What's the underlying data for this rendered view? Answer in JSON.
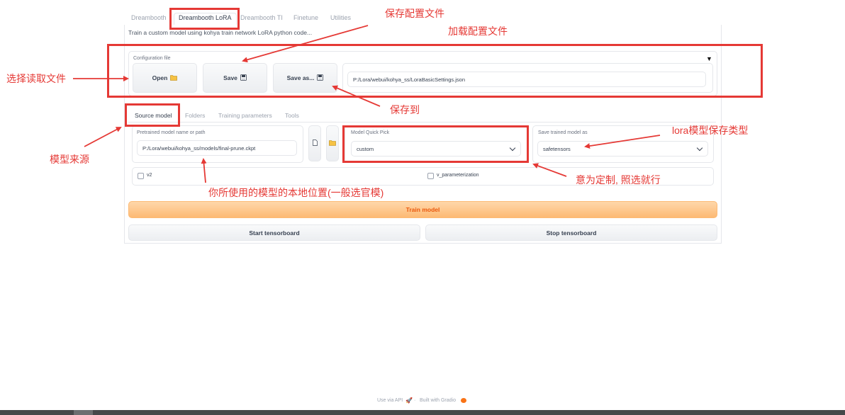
{
  "top_tabs": [
    "Dreambooth",
    "Dreambooth LoRA",
    "Dreambooth TI",
    "Finetune",
    "Utilities"
  ],
  "description": "Train a custom model using kohya train network LoRA python code...",
  "config": {
    "label": "Configuration file",
    "collapse_glyph": "▼",
    "open_label": "Open",
    "save_label": "Save",
    "save_as_label": "Save as...",
    "path_value": "P:/Lora/webui/kohya_ss/LoraBasicSettings.json"
  },
  "sub_tabs": [
    "Source model",
    "Folders",
    "Training parameters",
    "Tools"
  ],
  "source": {
    "pretrained_label": "Pretrained model name or path",
    "pretrained_value": "P:/Lora/webui/kohya_ss/models/final-prune.ckpt",
    "quick_pick_label": "Model Quick Pick",
    "quick_pick_value": "custom",
    "save_as_label": "Save trained model as",
    "save_as_value": "safetensors",
    "v2_label": "v2",
    "v_param_label": "v_parameterization"
  },
  "actions": {
    "train_label": "Train model",
    "start_tb_label": "Start tensorboard",
    "stop_tb_label": "Stop tensorboard"
  },
  "footer": {
    "api_label": "Use via API",
    "sep": "·",
    "built_label": "Built with Gradio"
  },
  "annotations": {
    "save_config": "保存配置文件",
    "load_config": "加载配置文件",
    "choose_file": "选择读取文件",
    "save_to": "保存到",
    "model_source": "模型来源",
    "lora_type": "lora模型保存类型",
    "custom_note": "意为定制, 照选就行",
    "local_path": "你所使用的模型的本地位置(一般选官模)"
  },
  "colors": {
    "annotation_red": "#e53935",
    "train_orange": "#fdba74",
    "train_text": "#ea580c"
  }
}
